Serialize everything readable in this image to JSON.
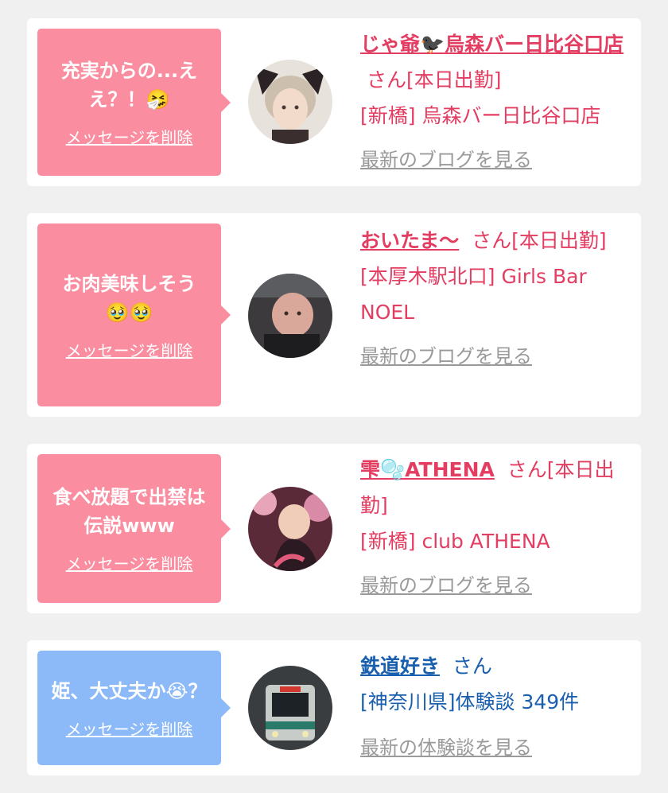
{
  "cards": [
    {
      "message": "充実からの...ええ？！",
      "message_emoji": "🤧",
      "delete_label": "メッセージを削除",
      "name": "じゃ爺🐦‍⬛烏森バー日比谷口店",
      "suffix": "さん[本日出勤]",
      "location": "[新橋] 烏森バー日比谷口店",
      "blog_link": "最新のブログを見る",
      "bubble_color": "#fa8d9f",
      "text_color": "#e33d62"
    },
    {
      "message": "お肉美味しそう",
      "message_emoji": "🥹🥹",
      "delete_label": "メッセージを削除",
      "name": "おいたま〜",
      "suffix": "さん[本日出勤]",
      "location": "[本厚木駅北口] Girls Bar NOEL",
      "blog_link": "最新のブログを見る",
      "bubble_color": "#fa8d9f",
      "text_color": "#e33d62"
    },
    {
      "message": "食べ放題で出禁は伝説www",
      "message_emoji": "",
      "delete_label": "メッセージを削除",
      "name": "雫🫧ATHENA",
      "suffix": "さん[本日出勤]",
      "location": "[新橋] club ATHENA",
      "blog_link": "最新のブログを見る",
      "bubble_color": "#fa8d9f",
      "text_color": "#e33d62"
    },
    {
      "message": "姫、大丈夫か😭？",
      "message_emoji": "",
      "delete_label": "メッセージを削除",
      "name": "鉄道好き",
      "suffix": "さん",
      "location": "[神奈川県]体験談 349件",
      "blog_link": "最新の体験談を見る",
      "bubble_color": "#8cbaf8",
      "text_color": "#1a5fae"
    }
  ]
}
